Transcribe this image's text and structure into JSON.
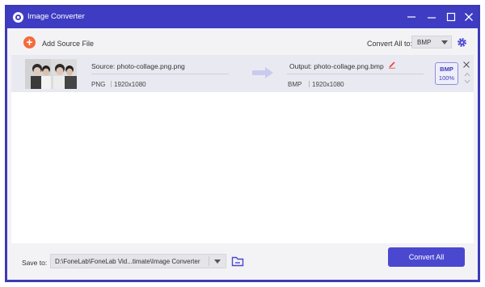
{
  "window": {
    "title": "Image Converter"
  },
  "toolbar": {
    "add_source_label": "Add Source File",
    "convert_all_to_label": "Convert All to:",
    "convert_all_to_value": "BMP"
  },
  "files": [
    {
      "source_label": "Source: photo-collage.png.png",
      "source_format": "PNG",
      "source_resolution": "1920x1080",
      "output_label": "Output: photo-collage.png.bmp",
      "output_format": "BMP",
      "output_resolution": "1920x1080",
      "badge_format": "BMP",
      "badge_quality": "100%"
    }
  ],
  "bottom": {
    "save_to_label": "Save to:",
    "save_path": "D:\\FoneLab\\FoneLab Vid...timate\\Image Converter",
    "convert_all_button": "Convert All"
  },
  "colors": {
    "title_bar": "#3e3cc2",
    "accent": "#4b48d0",
    "add_button": "#f36b3a",
    "edit_icon": "#e8433a"
  },
  "icons": {
    "app": "app-logo-icon",
    "minimize": "minimize-icon",
    "maximize": "maximize-icon",
    "close": "close-icon",
    "add": "plus-circle-icon",
    "settings": "gear-icon",
    "convert_arrow": "arrow-right-icon",
    "edit": "pencil-icon",
    "remove": "close-icon",
    "move_up": "chevron-up-icon",
    "move_down": "chevron-down-icon",
    "folder": "folder-icon"
  }
}
